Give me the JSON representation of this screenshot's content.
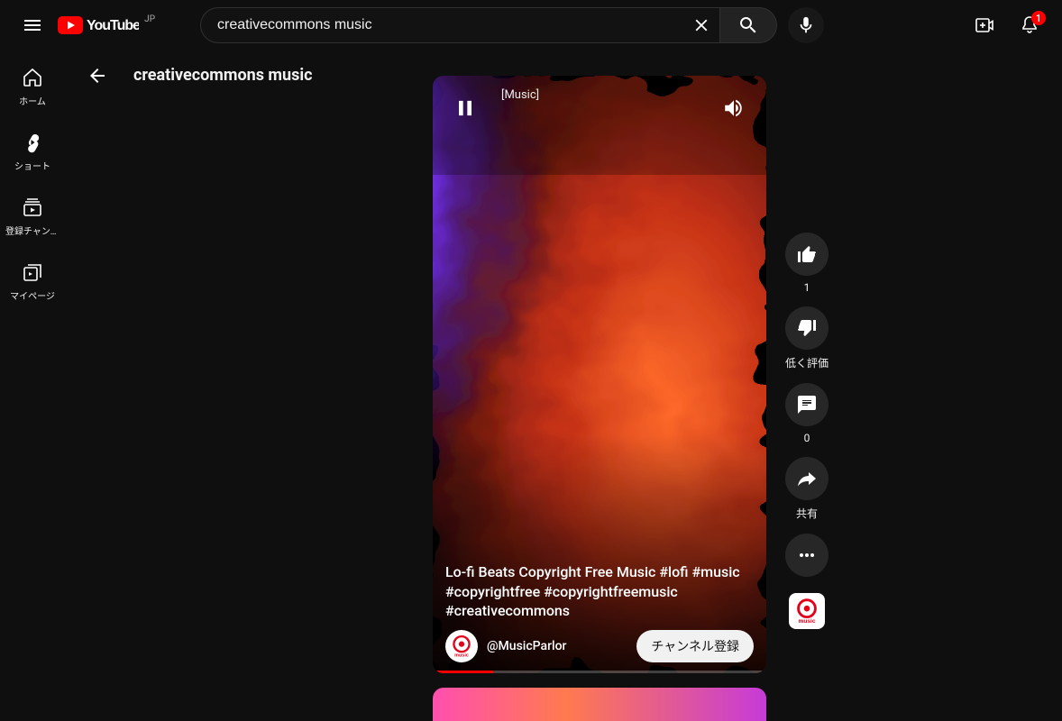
{
  "header": {
    "country": "JP",
    "search_value": "creativecommons music",
    "search_placeholder": "検索",
    "notif_count": "1"
  },
  "sidebar": {
    "items": [
      {
        "label": "ホーム"
      },
      {
        "label": "ショート"
      },
      {
        "label": "登録チャンネル"
      },
      {
        "label": "マイページ"
      }
    ]
  },
  "content": {
    "back_title": "creativecommons music"
  },
  "short": {
    "caption": "[Music]",
    "title": "Lo-fi Beats Copyright Free Music #lofi #music #copyrightfree #copyrightfreemusic #creativecommons",
    "handle": "@MusicParlor",
    "subscribe_label": "チャンネル登録"
  },
  "actions": {
    "like_count": "1",
    "dislike_label": "低く評価",
    "comment_count": "0",
    "share_label": "共有"
  }
}
